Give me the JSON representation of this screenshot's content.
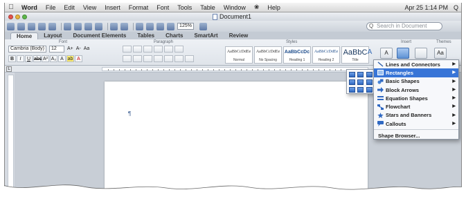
{
  "menubar": {
    "app_name": "Word",
    "items": [
      "File",
      "Edit",
      "View",
      "Insert",
      "Format",
      "Font",
      "Tools",
      "Table",
      "Window",
      "Help"
    ],
    "clock": "Apr 25  1:14 PM",
    "search_glyph": "Q"
  },
  "window": {
    "title": "Document1",
    "traffic_colors": [
      "#e4544c",
      "#e8b43c",
      "#5cb74a"
    ]
  },
  "toolbar": {
    "zoom": "125%",
    "search_placeholder": "Search in Document"
  },
  "ribbon": {
    "tabs": [
      "Home",
      "Layout",
      "Document Elements",
      "Tables",
      "Charts",
      "SmartArt",
      "Review"
    ],
    "active_tab": "Home",
    "groups": {
      "font": "Font",
      "paragraph": "Paragraph",
      "styles": "Styles",
      "insert": "Insert",
      "themes": "Themes"
    },
    "font_name": "Cambria (Body)",
    "font_size": "12",
    "format_buttons": [
      "B",
      "I",
      "U",
      "abc",
      "A²",
      "A₂",
      "A",
      "ab",
      "A"
    ],
    "size_buttons": [
      "A+",
      "A-",
      "Aa"
    ],
    "styles": [
      {
        "sample": "AaBbCcDdEe",
        "name": "Normal"
      },
      {
        "sample": "AaBbCcDdEe",
        "name": "No Spacing"
      },
      {
        "sample": "AaBbCcDc",
        "name": "Heading 1"
      },
      {
        "sample": "AaBbCcDdEe",
        "name": "Heading 2"
      },
      {
        "sample": "AaBbC",
        "name": "Title"
      }
    ]
  },
  "document": {
    "paragraph_mark": "¶"
  },
  "shapes_menu": {
    "items": [
      {
        "label": "Lines and Connectors",
        "has_submenu": true,
        "icon": "line-icon"
      },
      {
        "label": "Rectangles",
        "has_submenu": true,
        "icon": "rectangle-icon",
        "selected": true
      },
      {
        "label": "Basic Shapes",
        "has_submenu": true,
        "icon": "basic-shapes-icon"
      },
      {
        "label": "Block Arrows",
        "has_submenu": true,
        "icon": "block-arrow-icon"
      },
      {
        "label": "Equation Shapes",
        "has_submenu": true,
        "icon": "equation-icon"
      },
      {
        "label": "Flowchart",
        "has_submenu": true,
        "icon": "flowchart-icon"
      },
      {
        "label": "Stars and Banners",
        "has_submenu": true,
        "icon": "star-icon"
      },
      {
        "label": "Callouts",
        "has_submenu": true,
        "icon": "callout-icon"
      }
    ],
    "browser_label": "Shape Browser...",
    "arrow_glyph": "▶",
    "selected_color": "#3875d7"
  },
  "rectangles_submenu": {
    "shapes": [
      "rectangle",
      "rounded-rectangle",
      "snip-single-corner",
      "snip-same-side",
      "snip-diagonal",
      "round-single-corner",
      "round-same-side",
      "round-diagonal",
      "snip-and-round"
    ]
  }
}
